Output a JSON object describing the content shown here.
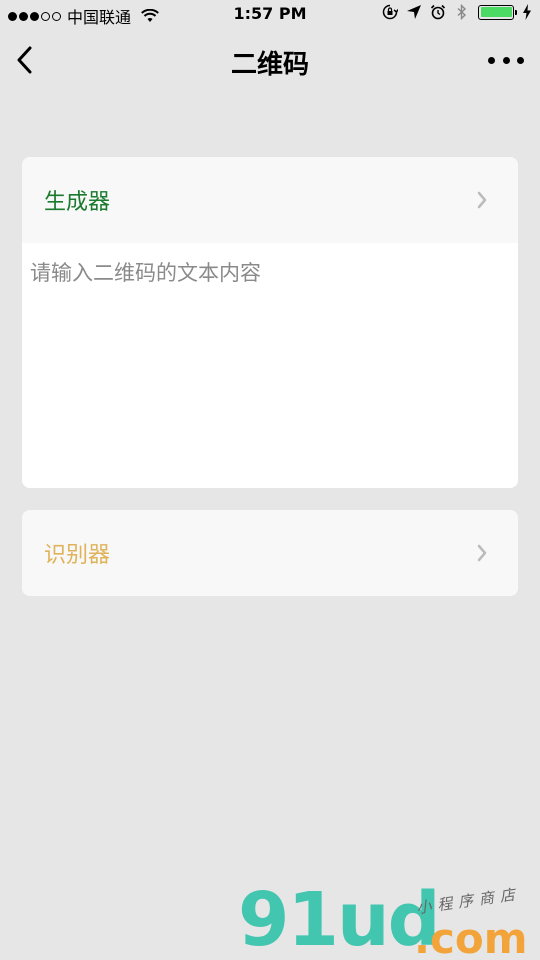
{
  "status_bar": {
    "carrier": "中国联通",
    "time": "1:57 PM",
    "battery_level": 1.0,
    "signal_strength": 3,
    "signal_max": 5
  },
  "nav": {
    "title": "二维码"
  },
  "generator": {
    "title": "生成器",
    "input_placeholder": "请输入二维码的文本内容",
    "input_value": ""
  },
  "scanner": {
    "title": "识别器"
  },
  "watermark": {
    "logo": "91ud",
    "domain": ".com",
    "tagline": "小程序商店"
  },
  "colors": {
    "generator_title": "#1a7a2e",
    "scanner_title": "#e0b35a",
    "page_background": "#e6e6e6",
    "battery_fill": "#4cd964"
  },
  "icons": [
    "wifi-icon",
    "orientation-lock-icon",
    "location-icon",
    "alarm-icon",
    "bluetooth-icon",
    "battery-icon",
    "charging-icon",
    "back-arrow-icon",
    "more-icon",
    "chevron-right-icon"
  ]
}
